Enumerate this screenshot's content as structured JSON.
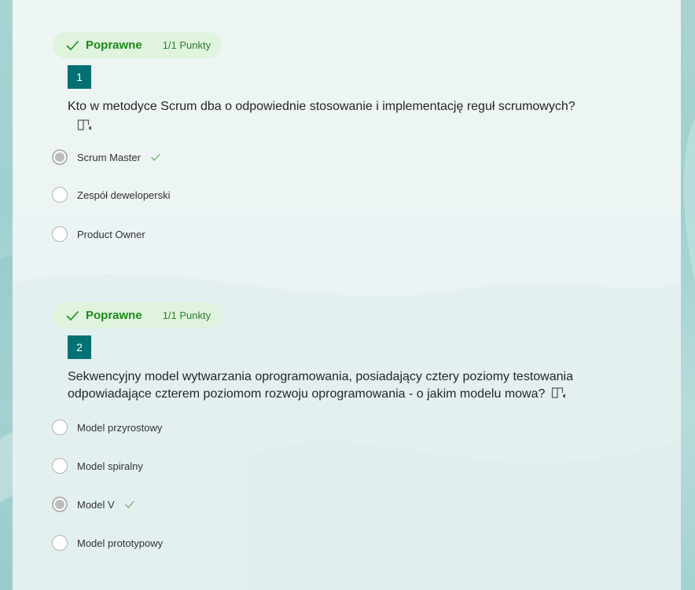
{
  "questions": [
    {
      "status": "Poprawne",
      "points": "1/1 Punkty",
      "number": "1",
      "text": "Kto w metodyce Scrum dba o odpowiednie stosowanie i implementację reguł scrumowych?",
      "options": [
        {
          "label": "Scrum Master",
          "selected": true,
          "correct": true
        },
        {
          "label": "Zespół deweloperski",
          "selected": false,
          "correct": false
        },
        {
          "label": "Product Owner",
          "selected": false,
          "correct": false
        }
      ]
    },
    {
      "status": "Poprawne",
      "points": "1/1 Punkty",
      "number": "2",
      "text_line1": "Sekwencyjny model wytwarzania oprogramowania, posiadający cztery poziomy testowania",
      "text_line2": "odpowiadające czterem poziomom rozwoju oprogramowania - o jakim modelu mowa?",
      "options": [
        {
          "label": "Model przyrostowy",
          "selected": false,
          "correct": false
        },
        {
          "label": "Model spiralny",
          "selected": false,
          "correct": false
        },
        {
          "label": "Model V",
          "selected": true,
          "correct": true
        },
        {
          "label": "Model prototypowy",
          "selected": false,
          "correct": false
        }
      ]
    }
  ],
  "icons": {
    "status": "checkmark-icon",
    "immersive_reader": "immersive-reader-icon",
    "correct_mark": "correct-check-icon"
  },
  "colors": {
    "status_text": "#1b8a1b",
    "status_pill_bg": "#dff3dd",
    "badge_bg": "#037073",
    "page_bg": "#a9d3d2",
    "card_bg": "#eef5f5"
  }
}
